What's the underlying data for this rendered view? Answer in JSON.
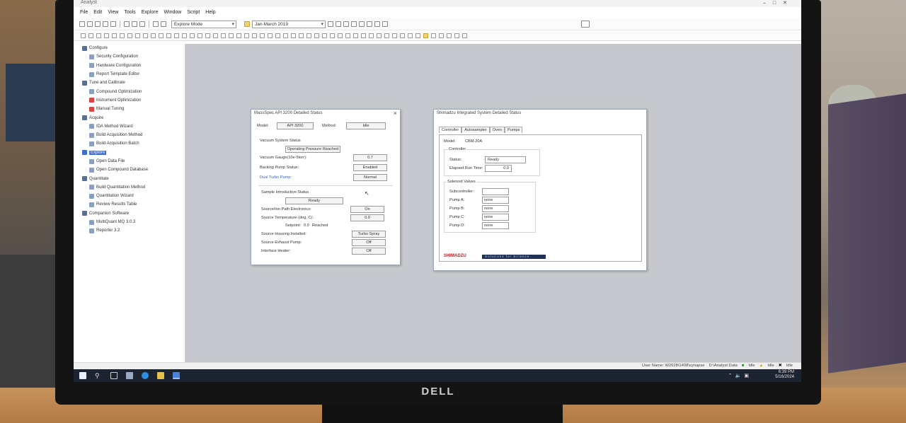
{
  "app": {
    "title": "Analyst"
  },
  "menu": [
    "File",
    "Edit",
    "View",
    "Tools",
    "Explore",
    "Window",
    "Script",
    "Help"
  ],
  "toolbar": {
    "mode": "Explore Mode",
    "project": "Jan-March 2019"
  },
  "nav": {
    "items": [
      {
        "label": "Configure",
        "level": 1
      },
      {
        "label": "Security Configuration",
        "level": 2
      },
      {
        "label": "Hardware Configuration",
        "level": 2
      },
      {
        "label": "Report Template Editor",
        "level": 2
      },
      {
        "label": "Tune and Calibrate",
        "level": 1
      },
      {
        "label": "Compound Optimization",
        "level": 2
      },
      {
        "label": "Instrument Optimization",
        "level": 2
      },
      {
        "label": "Manual Tuning",
        "level": 2
      },
      {
        "label": "Acquire",
        "level": 1
      },
      {
        "label": "IDA Method Wizard",
        "level": 2
      },
      {
        "label": "Build Acquisition Method",
        "level": 2
      },
      {
        "label": "Build Acquisition Batch",
        "level": 2
      },
      {
        "label": "Explore",
        "level": 1,
        "selected": true
      },
      {
        "label": "Open Data File",
        "level": 2
      },
      {
        "label": "Open Compound Database",
        "level": 2
      },
      {
        "label": "Quantitate",
        "level": 1
      },
      {
        "label": "Build Quantitation Method",
        "level": 2
      },
      {
        "label": "Quantitation Wizard",
        "level": 2
      },
      {
        "label": "Review Results Table",
        "level": 2
      },
      {
        "label": "Companion Software",
        "level": 1
      },
      {
        "label": "MultiQuant MQ 3.0.3",
        "level": 2
      },
      {
        "label": "Reporter 3.2",
        "level": 2
      }
    ]
  },
  "massspec": {
    "title": "MassSpec API 3200 Detailed Status",
    "model_label": "Model:",
    "model_value": "API 3200",
    "method_label": "Method:",
    "method_value": "Idle",
    "vacuum_header": "Vacuum System Status",
    "vacuum_status": "Operating Pressure Reached",
    "vacuum_gauge_label": "Vacuum Gauge(10e-5torr):",
    "vacuum_gauge_value": "0.7",
    "backing_label": "Backing Pump Status:",
    "backing_value": "Enabled",
    "turbo_label": "Dual Turbo Pump:",
    "turbo_value": "Normal",
    "sample_header": "Sample Introduction Status",
    "sample_status": "Ready",
    "ion_path_label": "Source/Ion Path Electronics:",
    "ion_path_value": "On",
    "temp_label": "Source Temperature (deg. C):",
    "temp_value": "0.0",
    "setpoint_label": "Setpoint:",
    "setpoint_value": "0.0",
    "reached_label": "Reached",
    "housing_label": "Source Housing Installed:",
    "housing_value": "Turbo Spray",
    "exhaust_label": "Source Exhaust Pump:",
    "exhaust_value": "Off",
    "heater_label": "Interface Heater:",
    "heater_value": "Off"
  },
  "shimadzu": {
    "title": "Shimadzu Integrated System Detailed Status",
    "tabs": [
      "Controller",
      "Autosampler",
      "Oven",
      "Pumps"
    ],
    "model_label": "Model:",
    "model_value": "CBM-20A",
    "controller_group": "Controller",
    "status_label": "Status:",
    "status_value": "Ready",
    "elapsed_label": "Elapsed Run Time:",
    "elapsed_value": "0.0",
    "valves_group": "Solenoid Valves",
    "subcontroller_label": "Subcontroller:",
    "subcontroller_value": "",
    "pump_a_label": "Pump A:",
    "pump_a_value": "none",
    "pump_b_label": "Pump B:",
    "pump_b_value": "none",
    "pump_c_label": "Pump C:",
    "pump_c_value": "none",
    "pump_d_label": "Pump D:",
    "pump_d_value": "none",
    "logo": "SHIMADZU",
    "tagline": "Solutions for Science"
  },
  "statusbar": {
    "user": "User Name: W2028\\1408\\synapse",
    "path": "D:\\Analyst Data",
    "state1": "Idle",
    "state2": "Idle",
    "state3": "Idle"
  },
  "taskbar": {
    "time": "6:39 PM",
    "date": "5/16/2024"
  },
  "monitor": {
    "brand": "DELL"
  },
  "colors": {
    "workspace": "#c6c8cd",
    "taskbar": "#1c2431",
    "selection": "#3a6fd0",
    "link_blue": "#2e5fd0"
  }
}
